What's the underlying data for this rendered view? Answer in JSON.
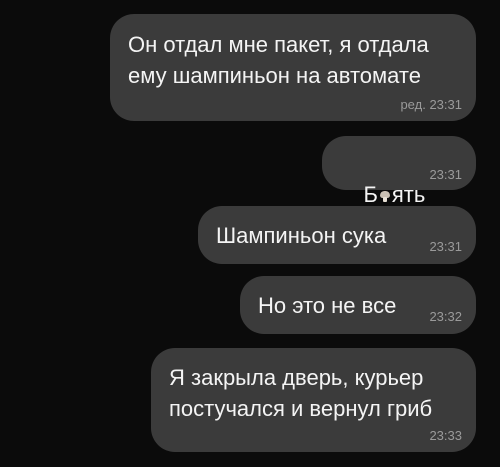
{
  "messages": [
    {
      "lines": [
        "Он отдал мне пакет, я отдала",
        "ему шампиньон на автомате"
      ],
      "edited_label": "ред.",
      "time": "23:31"
    },
    {
      "text_before_emoji": "Б",
      "emoji": "mushroom-icon",
      "text_after_emoji": "ять",
      "time": "23:31"
    },
    {
      "text": "Шампиньон сука",
      "time": "23:31"
    },
    {
      "text": "Но это не все",
      "time": "23:32"
    },
    {
      "lines": [
        "Я закрыла дверь, курьер",
        "постучался и вернул гриб"
      ],
      "time": "23:33"
    }
  ],
  "colors": {
    "background": "#0b0b0b",
    "bubble": "#3b3b3b",
    "text": "#f4f4f4",
    "meta": "#9a9a9a"
  }
}
